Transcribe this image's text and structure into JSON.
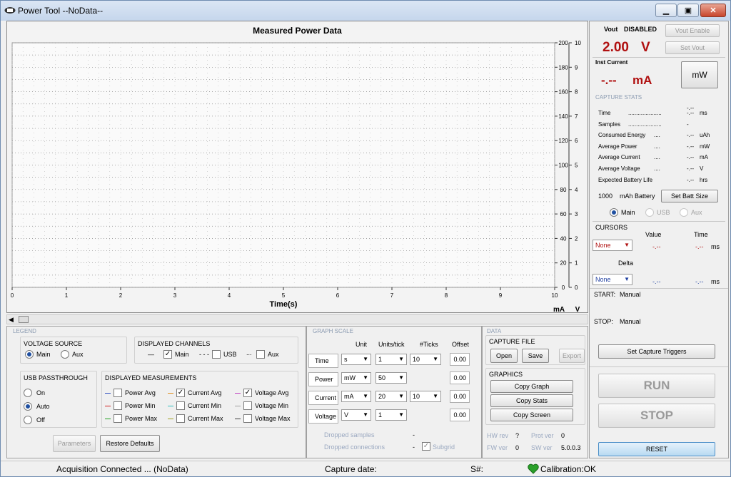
{
  "window": {
    "title": "Power Tool --NoData--"
  },
  "chart_data": {
    "type": "line",
    "title": "Measured Power Data",
    "xlabel": "Time(s)",
    "xlim": [
      0,
      10
    ],
    "x_ticks": [
      "0",
      "1",
      "2",
      "3",
      "4",
      "5",
      "6",
      "7",
      "8",
      "9",
      "10"
    ],
    "y_left_ticks": [
      "0",
      "20",
      "40",
      "60",
      "80",
      "100",
      "120",
      "140",
      "160",
      "180",
      "200"
    ],
    "y_right_ticks": [
      "0",
      "1",
      "2",
      "3",
      "4",
      "5",
      "6",
      "7",
      "8",
      "9",
      "10"
    ],
    "ylim_left": [
      0,
      200
    ],
    "ylim_right": [
      0,
      10
    ],
    "unit_left": "mA",
    "unit_right": "V",
    "series": [],
    "grid": true
  },
  "legend": {
    "section": "LEGEND",
    "voltage_source": {
      "title": "VOLTAGE SOURCE",
      "main": "Main",
      "aux": "Aux"
    },
    "displayed_channels": {
      "title": "DISPLAYED CHANNELS",
      "main": "Main",
      "usb": "USB",
      "aux": "Aux",
      "main_line": "—",
      "usb_line": "- - -",
      "aux_line": "..."
    },
    "usb_passthrough": {
      "title": "USB PASSTHROUGH",
      "on": "On",
      "auto": "Auto",
      "off": "Off"
    },
    "displayed_measurements": {
      "title": "DISPLAYED MEASUREMENTS",
      "col1": [
        "Power Avg",
        "Power Min",
        "Power Max"
      ],
      "col2": [
        "Current Avg",
        "Current Min",
        "Current Max"
      ],
      "col3": [
        "Voltage Avg",
        "Voltage Min",
        "Voltage Max"
      ]
    },
    "parameters": "Parameters",
    "restore": "Restore Defaults"
  },
  "graph_scale": {
    "section": "GRAPH SCALE",
    "headers": {
      "unit": "Unit",
      "units_tick": "Units/tick",
      "ticks": "#Ticks",
      "offset": "Offset"
    },
    "rows": [
      {
        "label": "Time",
        "unit": "s",
        "upt": "1",
        "ticks": "10",
        "offset": "0.00"
      },
      {
        "label": "Power",
        "unit": "mW",
        "upt": "50",
        "ticks": "",
        "offset": "0.00"
      },
      {
        "label": "Current",
        "unit": "mA",
        "upt": "20",
        "ticks": "10",
        "offset": "0.00"
      },
      {
        "label": "Voltage",
        "unit": "V",
        "upt": "1",
        "ticks": "",
        "offset": "0.00"
      }
    ],
    "dropped_samples": "Dropped samples",
    "dropped_samples_val": "-",
    "dropped_connections": "Dropped connections",
    "dropped_connections_val": "-",
    "subgrid": "Subgrid"
  },
  "data": {
    "section": "DATA",
    "capture_file": "CAPTURE FILE",
    "open": "Open",
    "save": "Save",
    "export": "Export",
    "graphics": "GRAPHICS",
    "copy_graph": "Copy Graph",
    "copy_stats": "Copy Stats",
    "copy_screen": "Copy Screen",
    "hw_rev": "HW rev",
    "hw_rev_val": "?",
    "prot_ver": "Prot ver",
    "prot_ver_val": "0",
    "fw_ver": "FW ver",
    "fw_ver_val": "0",
    "sw_ver": "SW ver",
    "sw_ver_val": "5.0.0.3"
  },
  "right": {
    "vout_label": "Vout",
    "vout_state": "DISABLED",
    "vout_value": "2.00",
    "vout_unit": "V",
    "vout_enable": "Vout Enable",
    "set_vout": "Set Vout",
    "inst_current": "Inst Current",
    "inst_value": "-.--",
    "inst_unit": "mA",
    "mw": "mW",
    "capture_stats": "CAPTURE STATS",
    "stats_top": "-.--",
    "stats": [
      {
        "label": "Time",
        "dots": ".....................",
        "val": "-.--",
        "unit": "ms"
      },
      {
        "label": "Samples",
        "dots": ".....................",
        "val": "-",
        "unit": ""
      },
      {
        "label": "Consumed Energy",
        "dots": "....",
        "val": "-.--",
        "unit": "uAh"
      },
      {
        "label": "Average Power",
        "dots": "....",
        "val": "-.--",
        "unit": "mW"
      },
      {
        "label": "Average Current",
        "dots": "....",
        "val": "-.--",
        "unit": "mA"
      },
      {
        "label": "Average Voltage",
        "dots": "....",
        "val": "-.--",
        "unit": "V"
      },
      {
        "label": "Expected Battery Life",
        "dots": "",
        "val": "-.--",
        "unit": "hrs"
      }
    ],
    "battery_value": "1000",
    "battery_label": "mAh Battery",
    "set_batt": "Set Batt Size",
    "src_main": "Main",
    "src_usb": "USB",
    "src_aux": "Aux",
    "cursors": "CURSORS",
    "value": "Value",
    "time": "Time",
    "cursor1": "None",
    "c1_val": "-.--",
    "c1_time": "-.--",
    "c1_unit": "ms",
    "delta": "Delta",
    "cursor2": "None",
    "c2_val": "-.--",
    "c2_time": "-.--",
    "c2_unit": "ms",
    "start": "START:",
    "start_val": "Manual",
    "stop": "STOP:",
    "stop_val": "Manual",
    "set_triggers": "Set Capture Triggers",
    "run": "RUN",
    "stop_btn": "STOP",
    "reset": "RESET"
  },
  "status": {
    "acq": "Acquisition Connected ... (NoData)",
    "capture_date": "Capture date:",
    "serial": "S#:",
    "calibration": "Calibration:OK"
  }
}
